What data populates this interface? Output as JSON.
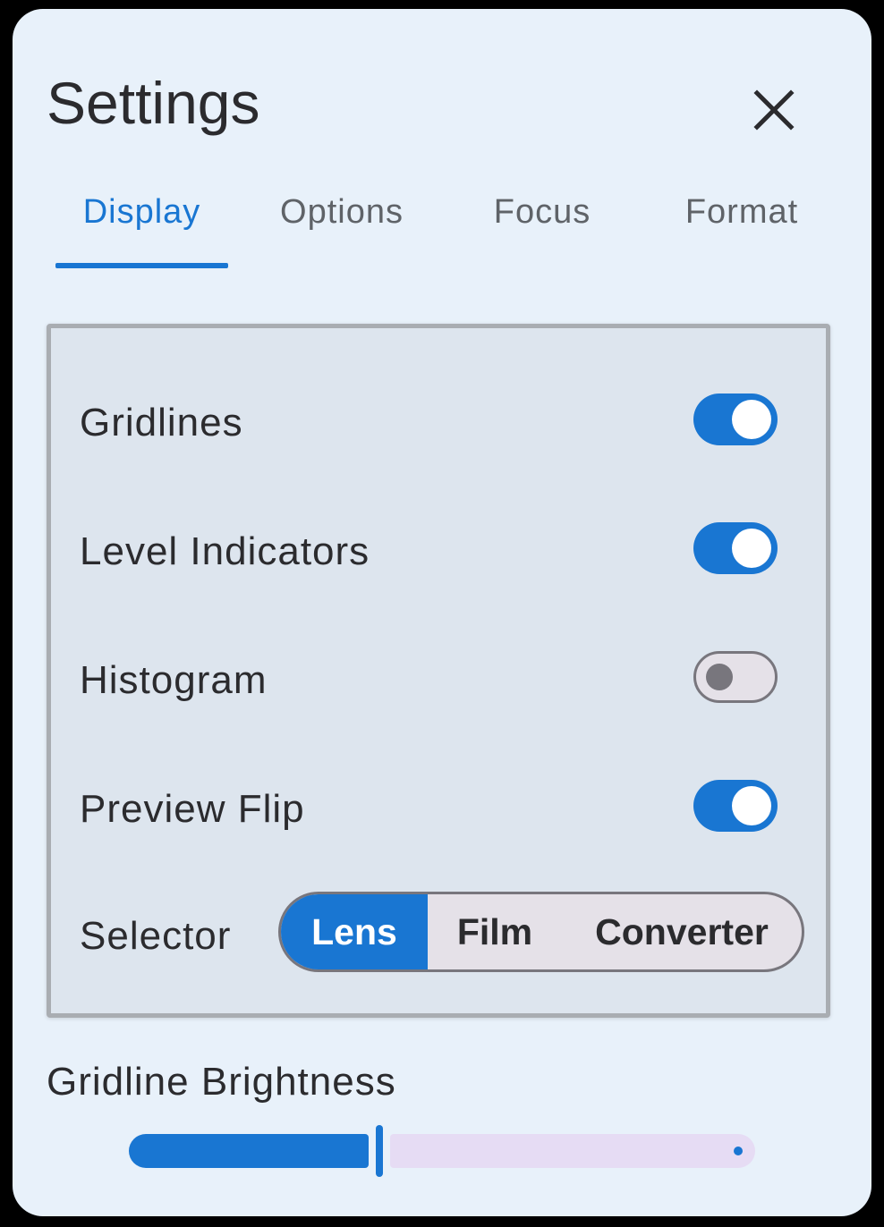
{
  "dialog": {
    "title": "Settings",
    "close_icon": "close-icon"
  },
  "tabs": [
    {
      "label": "Display",
      "active": true
    },
    {
      "label": "Options",
      "active": false
    },
    {
      "label": "Focus",
      "active": false
    },
    {
      "label": "Format",
      "active": false
    }
  ],
  "display_settings": {
    "toggles": [
      {
        "label": "Gridlines",
        "on": true
      },
      {
        "label": "Level Indicators",
        "on": true
      },
      {
        "label": "Histogram",
        "on": false
      },
      {
        "label": "Preview Flip",
        "on": true
      }
    ],
    "selector": {
      "label": "Selector",
      "options": [
        "Lens",
        "Film",
        "Converter"
      ],
      "selected": "Lens"
    }
  },
  "gridline_brightness": {
    "label": "Gridline Brightness",
    "value_fraction": 0.4
  },
  "colors": {
    "accent": "#1976d2",
    "panel_background": "#e8f1fa",
    "card_background": "#dde5ee",
    "inactive_track": "#e6dcf4"
  }
}
